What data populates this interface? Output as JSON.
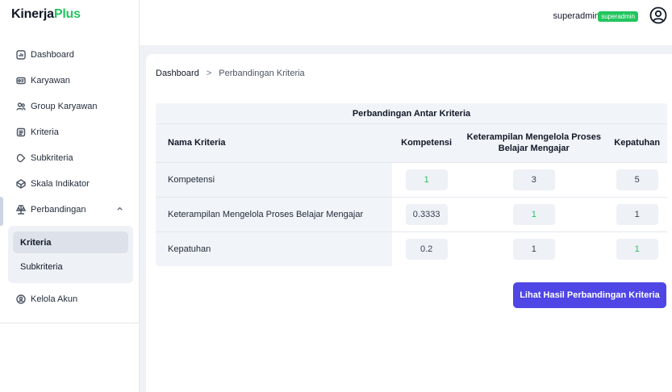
{
  "brand": {
    "part1": "Kinerja",
    "part2": "Plus"
  },
  "sidebar": {
    "items": [
      {
        "label": "Dashboard",
        "icon": "dashboard-icon"
      },
      {
        "label": "Karyawan",
        "icon": "id-card-icon"
      },
      {
        "label": "Group Karyawan",
        "icon": "group-icon"
      },
      {
        "label": "Kriteria",
        "icon": "list-icon"
      },
      {
        "label": "Subkriteria",
        "icon": "tag-icon"
      },
      {
        "label": "Skala Indikator",
        "icon": "scale-icon"
      },
      {
        "label": "Perbandingan",
        "icon": "compare-icon"
      }
    ],
    "submenu": [
      {
        "label": "Kriteria"
      },
      {
        "label": "Subkriteria"
      }
    ],
    "account": {
      "label": "Kelola Akun",
      "icon": "user-settings-icon"
    }
  },
  "header": {
    "username": "superadmin",
    "role": "superadmin"
  },
  "breadcrumb": {
    "home": "Dashboard",
    "separator": ">",
    "current": "Perbandingan Kriteria"
  },
  "table": {
    "title": "Perbandingan Antar Kriteria",
    "headers": [
      "Nama Kriteria",
      "Kompetensi",
      "Keterampilan Mengelola Proses Belajar Mengajar",
      "Kepatuhan"
    ],
    "rows": [
      {
        "name": "Kompetensi",
        "values": [
          "1",
          "3",
          "5"
        ]
      },
      {
        "name": "Keterampilan Mengelola Proses Belajar Mengajar",
        "values": [
          "0.3333",
          "1",
          "1"
        ]
      },
      {
        "name": "Kepatuhan",
        "values": [
          "0.2",
          "1",
          "1"
        ]
      }
    ]
  },
  "actions": {
    "view_result_label": "Lihat Hasil Perbandingan Kriteria"
  },
  "colors": {
    "brand_green": "#22c55e",
    "primary": "#4f46e5",
    "background": "#eef1f6"
  }
}
